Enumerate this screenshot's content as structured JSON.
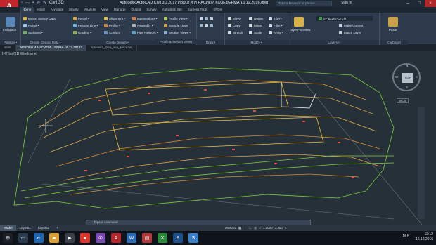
{
  "app": {
    "logo": "A",
    "title": "Autodesk AutoCAD Civil 3D 2017   ИЗКОГИ И НАСИПИ КОЗЕФЕРМА 16.12.2016.dwg",
    "workspace": "Civil 3D",
    "search_placeholder": "Type a keyword or phrase",
    "signin": "Sign In"
  },
  "tabs": [
    "Home",
    "Insert",
    "Annotate",
    "Modify",
    "Analyze",
    "View",
    "Manage",
    "Output",
    "Survey",
    "Autodesk 360",
    "Express Tools",
    "SPDS"
  ],
  "ribbon": {
    "toolspace": "Toolspace",
    "g1": [
      "Import Survey Data",
      "Points •",
      "Surfaces •"
    ],
    "g2": [
      "Parcel •",
      "Feature Line •",
      "Grading •"
    ],
    "g3": [
      "Alignment •",
      "Profile •",
      "Corridor"
    ],
    "g4": [
      "Intersections •",
      "Assembly •",
      "Pipe Network •"
    ],
    "g5": [
      "Profile View •",
      "Sample Lines",
      "Section Views •"
    ],
    "g6": [
      "Move",
      "Copy",
      "Stretch"
    ],
    "g7": [
      "Rotate",
      "Mirror",
      "Scale"
    ],
    "g8": [
      "Trim •",
      "Fillet •",
      "Array •"
    ],
    "layer_name": "0 - BLDG-CTLN",
    "layer_items": [
      "Make Current",
      "Match Layer"
    ],
    "layer_props": "Layer Properties",
    "paste": "Paste",
    "group_labels": [
      "Palettes •",
      "Create Ground Data •",
      "Create Design •",
      "Profile & Section Views",
      "Draw •",
      "Modify •",
      "Layers •",
      "Clipboard"
    ]
  },
  "doc_tabs": [
    "Start",
    "ИЗКОГИ И НАСИПИ ...ЕРМА 16.12.2016*",
    "Бланкет_фон_пер_месила*"
  ],
  "viewport_label": "[–][Top][2D Wireframe]",
  "viewcube": {
    "top": "TOP",
    "n": "N",
    "s": "S",
    "e": "E",
    "w": "W"
  },
  "wcs": "WCS",
  "command_placeholder": "Type a command",
  "layout_tabs": [
    "Model",
    "Layout1",
    "Layout2",
    "+"
  ],
  "status": {
    "model": "MODEL",
    "scale": "1:1000",
    "value": "3.300"
  },
  "taskbar": {
    "lang": "БГР",
    "time": "13:12",
    "date": "16.12.2016"
  }
}
